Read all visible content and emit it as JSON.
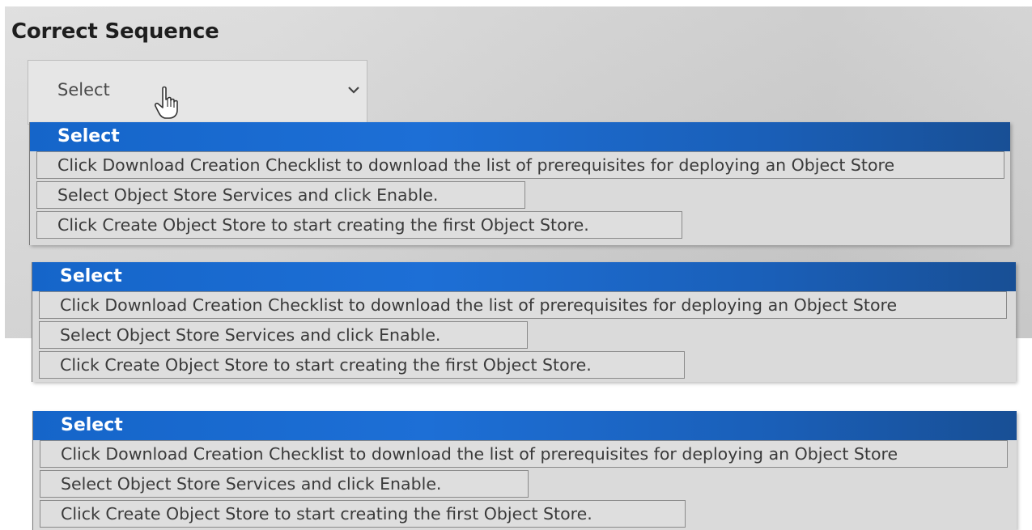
{
  "heading": "Correct Sequence",
  "select": {
    "value": "Select"
  },
  "dropdowns": [
    {
      "header": "Select",
      "options": [
        "Click Download Creation Checklist to download the list of prerequisites for deploying an Object Store",
        "Select Object Store Services and click Enable.",
        "Click Create Object Store to start creating the first Object Store."
      ]
    },
    {
      "header": "Select",
      "options": [
        "Click Download Creation Checklist to download the list of prerequisites for deploying an Object Store",
        "Select Object Store Services and click Enable.",
        "Click Create Object Store to start creating the first Object Store."
      ]
    },
    {
      "header": "Select",
      "options": [
        "Click Download Creation Checklist to download the list of prerequisites for deploying an Object Store",
        "Select Object Store Services and click Enable.",
        "Click Create Object Store to start creating the first Object Store."
      ]
    }
  ],
  "icons": {
    "chevron": "chevron-down-icon",
    "cursor": "hand-pointer-icon"
  },
  "colors": {
    "selected_highlight": "#1d6fd6",
    "option_background": "#dedede"
  }
}
